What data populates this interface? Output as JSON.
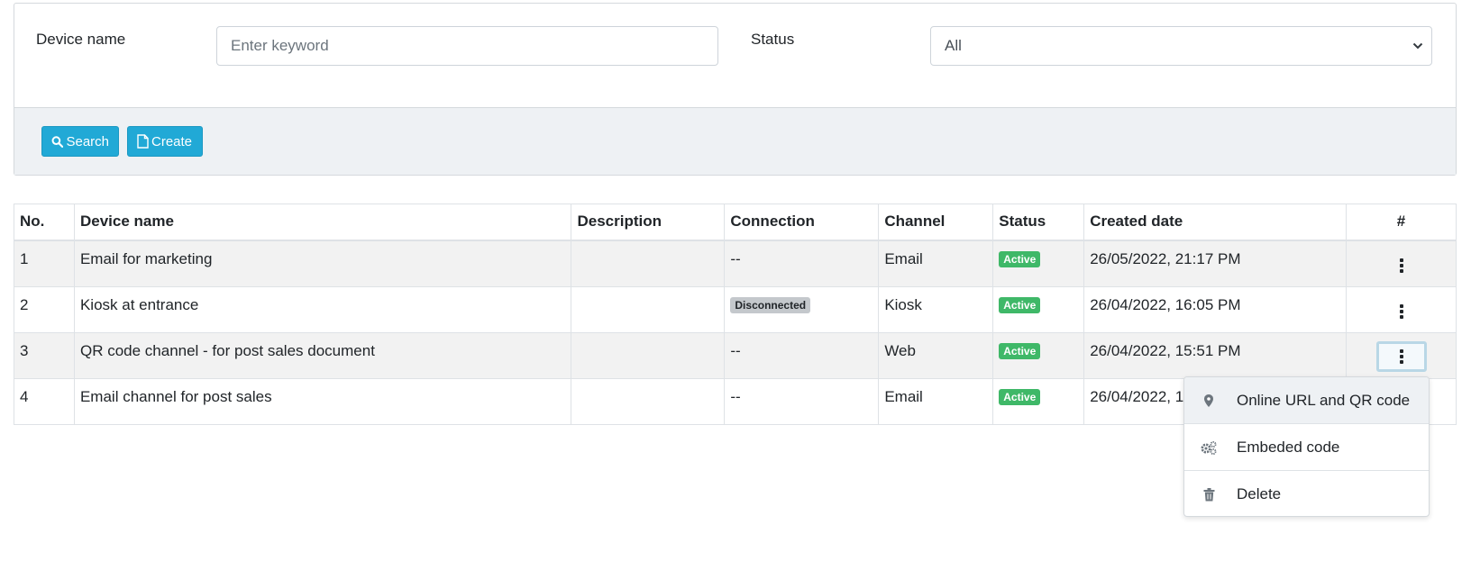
{
  "filters": {
    "device_name_label": "Device name",
    "device_name_placeholder": "Enter keyword",
    "status_label": "Status",
    "status_value": "All"
  },
  "buttons": {
    "search": "Search",
    "create": "Create"
  },
  "table": {
    "headers": [
      "No.",
      "Device name",
      "Description",
      "Connection",
      "Channel",
      "Status",
      "Created date",
      "#"
    ],
    "rows": [
      {
        "no": "1",
        "name": "Email for marketing",
        "description": "",
        "connection": "--",
        "channel": "Email",
        "status": "Active",
        "created": "26/05/2022, 21:17 PM"
      },
      {
        "no": "2",
        "name": "Kiosk at entrance",
        "description": "",
        "connection": "Disconnected",
        "channel": "Kiosk",
        "status": "Active",
        "created": "26/04/2022, 16:05 PM"
      },
      {
        "no": "3",
        "name": "QR code channel - for post sales document",
        "description": "",
        "connection": "--",
        "channel": "Web",
        "status": "Active",
        "created": "26/04/2022, 15:51 PM"
      },
      {
        "no": "4",
        "name": "Email channel for post sales",
        "description": "",
        "connection": "--",
        "channel": "Email",
        "status": "Active",
        "created": "26/04/2022, 1"
      }
    ]
  },
  "dropdown": {
    "items": [
      {
        "label": "Online URL and QR code",
        "icon": "map-pin-icon"
      },
      {
        "label": "Embeded code",
        "icon": "gears-icon"
      },
      {
        "label": "Delete",
        "icon": "trash-icon"
      }
    ]
  },
  "colors": {
    "primary_button": "#21a9d6",
    "active_badge": "#3fb868",
    "disconnected_badge": "#c4c8cc",
    "filter_footer": "#eef1f4"
  }
}
